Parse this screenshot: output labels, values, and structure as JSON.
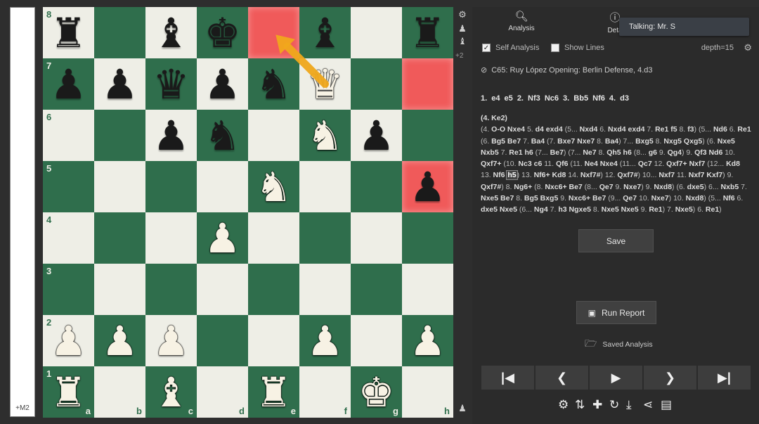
{
  "eval_bar": {
    "label": "+M2"
  },
  "board": {
    "files": [
      "a",
      "b",
      "c",
      "d",
      "e",
      "f",
      "g",
      "h"
    ],
    "ranks": [
      "8",
      "7",
      "6",
      "5",
      "4",
      "3",
      "2",
      "1"
    ],
    "highlighted": [
      "e8",
      "h7",
      "h5"
    ],
    "pieces": {
      "a8": "bR",
      "c8": "bB",
      "d8": "bK",
      "f8": "bB",
      "h8": "bR",
      "a7": "bP",
      "b7": "bP",
      "c7": "bQ",
      "d7": "bP",
      "e7": "bN",
      "f7": "wQ",
      "c6": "bP",
      "d6": "bN",
      "f6": "wN",
      "g6": "bP",
      "e5": "wN",
      "h5": "bP",
      "d4": "wP",
      "a2": "wP",
      "b2": "wP",
      "c2": "wP",
      "f2": "wP",
      "h2": "wP",
      "a1": "wR",
      "c1": "wB",
      "e1": "wR",
      "g1": "wK"
    },
    "arrow": {
      "from": "f7",
      "to": "e8",
      "color": "#f0a81c"
    }
  },
  "board_side": {
    "score": "+2"
  },
  "panel": {
    "tabs": [
      {
        "label": "Analysis",
        "icon": "magnifier-icon"
      },
      {
        "label": "Deta",
        "icon": "info-icon"
      }
    ],
    "tooltip": "Talking: Mr. S",
    "self_analysis_label": "Self Analysis",
    "show_lines_label": "Show Lines",
    "depth": "depth=15",
    "opening": "C65: Ruy López Opening: Berlin Defense, 4.d3",
    "mainline": "1. e4 e5 2. Nf3 Nc6 3. Bb5 Nf6 4. d3",
    "variation_head": "(4. Ke2)",
    "save_label": "Save",
    "run_report_label": "Run Report",
    "saved_analysis_label": "Saved Analysis"
  }
}
